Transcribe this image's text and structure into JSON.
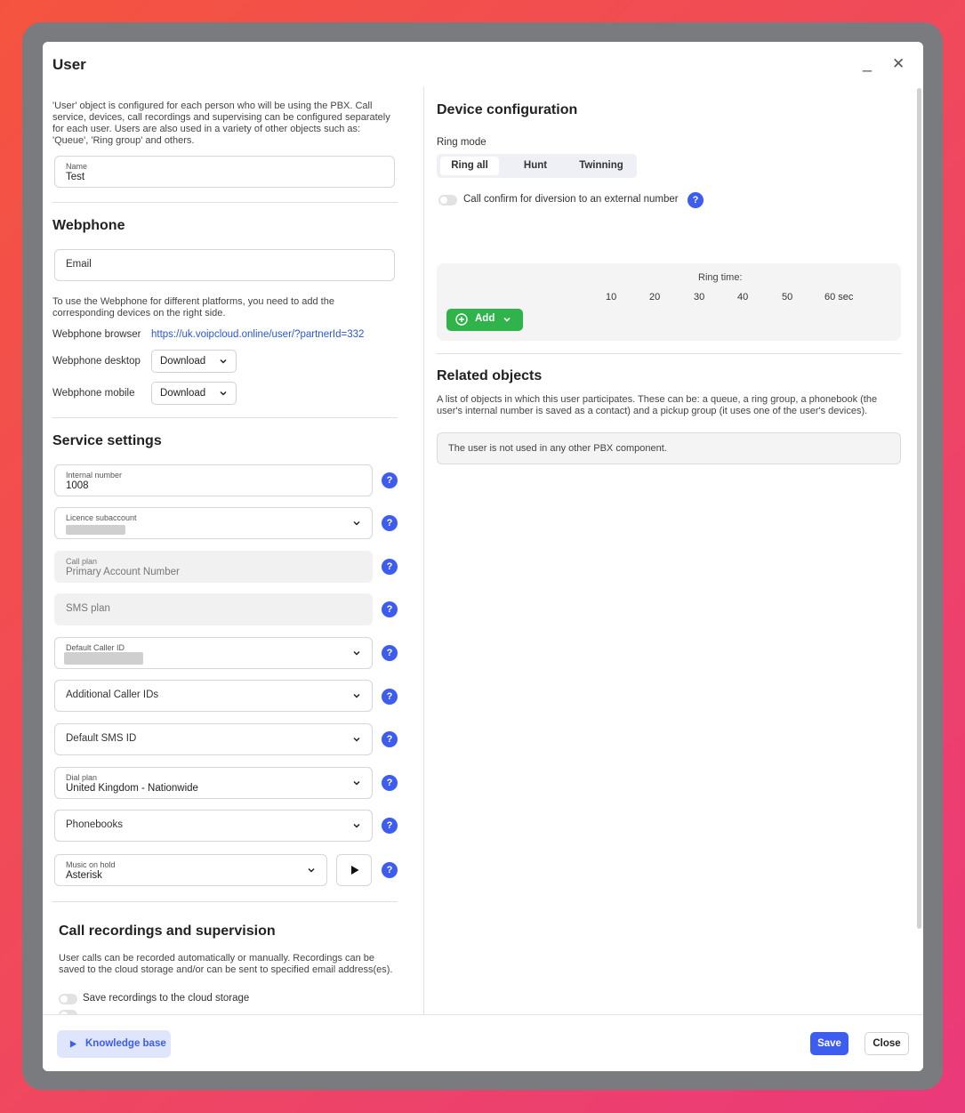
{
  "dialog": {
    "title": "User",
    "minimize_glyph": "_",
    "close_glyph": "✕"
  },
  "left": {
    "intro": "'User' object is configured for each person who will be using the PBX. Call service, devices, call recordings and supervising can be configured separately for each user. Users are also used in a variety of other objects such as: 'Queue', 'Ring group' and others.",
    "name_field": {
      "label": "Name",
      "value": "Test"
    },
    "webphone": {
      "heading": "Webphone",
      "email_placeholder": "Email",
      "note": "To use the Webphone for different platforms, you need to add the corresponding devices on the right side.",
      "browser_label": "Webphone browser",
      "browser_link": "https://uk.voipcloud.online/user/?partnerId=332",
      "desktop_label": "Webphone desktop",
      "desktop_button": "Download",
      "mobile_label": "Webphone mobile",
      "mobile_button": "Download"
    },
    "service": {
      "heading": "Service settings",
      "internal_number": {
        "label": "Internal number",
        "value": "1008"
      },
      "licence": {
        "label": "Licence subaccount"
      },
      "call_plan": {
        "label": "Call plan",
        "value": "Primary Account Number"
      },
      "sms_plan": {
        "placeholder": "SMS plan"
      },
      "default_caller_id": {
        "label": "Default Caller ID"
      },
      "additional_caller_ids": {
        "placeholder": "Additional Caller IDs"
      },
      "default_sms_id": {
        "placeholder": "Default SMS ID"
      },
      "dial_plan": {
        "label": "Dial plan",
        "value": "United Kingdom - Nationwide"
      },
      "phonebooks": {
        "placeholder": "Phonebooks"
      },
      "music_on_hold": {
        "label": "Music on hold",
        "value": "Asterisk"
      },
      "help_glyph": "?"
    },
    "recordings": {
      "heading": "Call recordings and supervision",
      "text": "User calls can be recorded automatically or manually. Recordings can be saved to the cloud storage and/or can be sent to specified email address(es).",
      "save_cloud": "Save recordings to the cloud storage"
    }
  },
  "right": {
    "device_heading": "Device configuration",
    "ring_mode_label": "Ring mode",
    "ring_modes": [
      "Ring all",
      "Hunt",
      "Twinning"
    ],
    "ring_mode_selected": "Ring all",
    "call_confirm": "Call confirm for diversion to an external number",
    "ring_time_label": "Ring time:",
    "ring_ticks": [
      "10",
      "20",
      "30",
      "40",
      "50",
      "60 sec"
    ],
    "add_button": "Add",
    "related_heading": "Related objects",
    "related_text": "A list of objects in which this user participates. These can be: a queue, a ring group, a phonebook (the user's internal number is saved as a contact) and a pickup group (it uses one of the user's devices).",
    "related_empty": "The user is not used in any other PBX component."
  },
  "footer": {
    "knowledge_base": "Knowledge base",
    "save": "Save",
    "close": "Close"
  },
  "colors": {
    "accent": "#3d5cf0",
    "add_green": "#2fb34a",
    "link": "#2a56d6"
  }
}
